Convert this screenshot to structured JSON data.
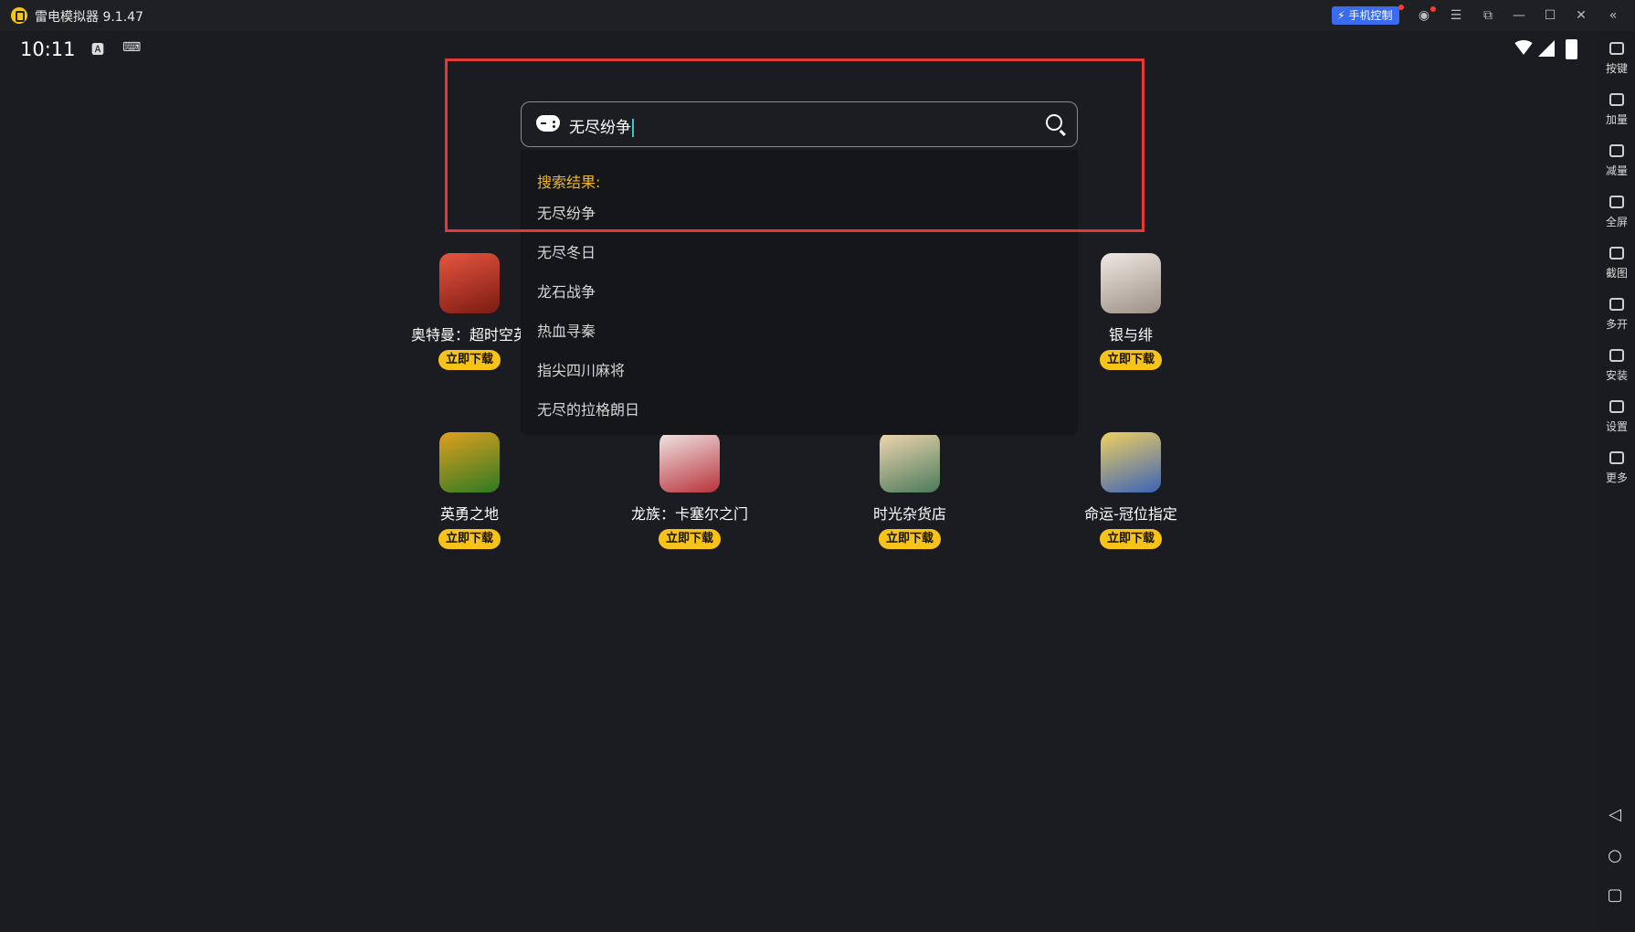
{
  "titlebar": {
    "app_title": "雷电模拟器 9.1.47",
    "phone_control_label": "手机控制"
  },
  "statusbar": {
    "time": "10:11"
  },
  "sidebar": {
    "items": [
      {
        "label": "按键",
        "icon": "keyboard-icon"
      },
      {
        "label": "加量",
        "icon": "volume-up-icon"
      },
      {
        "label": "减量",
        "icon": "volume-down-icon"
      },
      {
        "label": "全屏",
        "icon": "fullscreen-icon"
      },
      {
        "label": "截图",
        "icon": "scissors-icon"
      },
      {
        "label": "多开",
        "icon": "multi-instance-icon"
      },
      {
        "label": "安装",
        "icon": "apk-install-icon"
      },
      {
        "label": "设置",
        "icon": "gear-icon"
      },
      {
        "label": "更多",
        "icon": "more-icon"
      }
    ]
  },
  "search": {
    "value": "无尽纷争",
    "results_header": "搜索结果:",
    "results": [
      "无尽纷争",
      "无尽冬日",
      "龙石战争",
      "热血寻秦",
      "指尖四川麻将",
      "无尽的拉格朗日"
    ]
  },
  "games": [
    {
      "name": "奥特曼：超时空英",
      "button": "立即下载",
      "color": "#c7372a"
    },
    {
      "name": "银与绯",
      "button": "立即下载",
      "color": "#c9c2bb"
    },
    {
      "name": "英勇之地",
      "button": "立即下载",
      "color": "#3d8a2a"
    },
    {
      "name": "龙族：卡塞尔之门",
      "button": "立即下载",
      "color": "#b8323a"
    },
    {
      "name": "时光杂货店",
      "button": "立即下载",
      "color": "#c9a17a"
    },
    {
      "name": "命运-冠位指定",
      "button": "立即下载",
      "color": "#3a63b8"
    }
  ],
  "colors": {
    "accent_yellow": "#f7c318",
    "highlight_red": "#e53935",
    "phone_control_blue": "#3b6cf0"
  }
}
